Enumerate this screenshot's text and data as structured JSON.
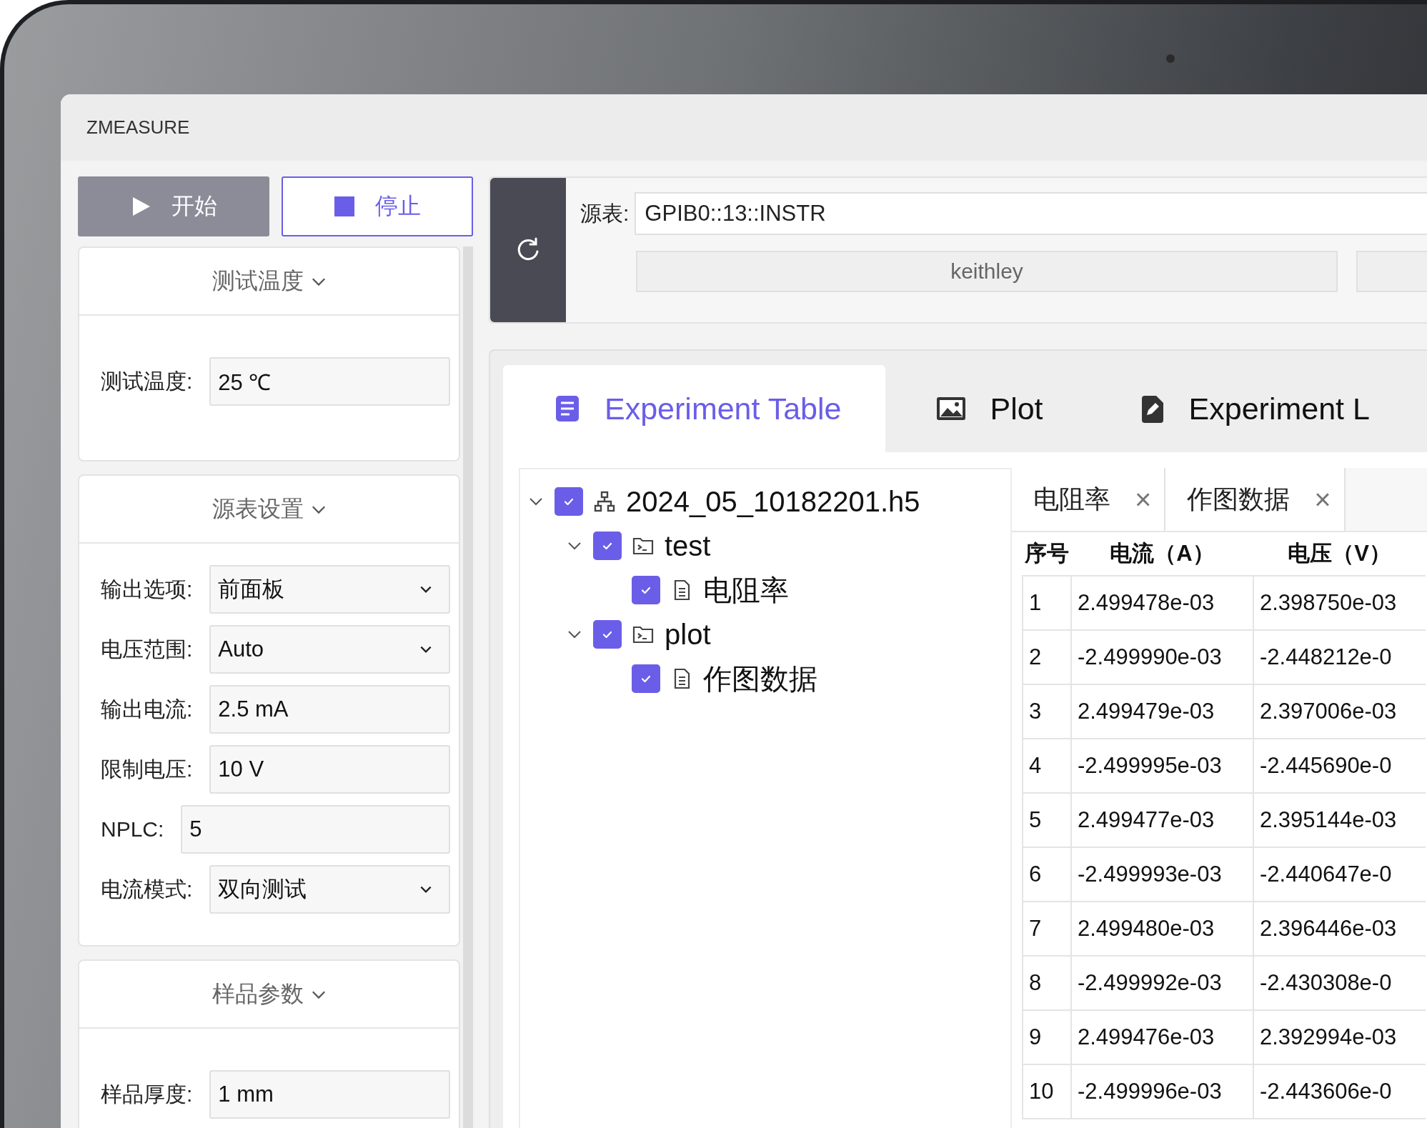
{
  "window": {
    "title": "ZMEASURE"
  },
  "run_buttons": [
    {
      "label": "开始",
      "kind": "start",
      "disabled": true
    },
    {
      "label": "停止",
      "kind": "stop",
      "disabled": false
    }
  ],
  "settings_sections": [
    {
      "title": "测试温度",
      "expanded": true,
      "fields": [
        {
          "label": "测试温度:",
          "value": "25 ℃",
          "kind": "input"
        }
      ]
    },
    {
      "title": "源表设置",
      "expanded": true,
      "fields": [
        {
          "label": "输出选项:",
          "value": "前面板",
          "kind": "select"
        },
        {
          "label": "电压范围:",
          "value": "Auto",
          "kind": "select"
        },
        {
          "label": "输出电流:",
          "value": "2.5 mA",
          "kind": "input"
        },
        {
          "label": "限制电压:",
          "value": "10 V",
          "kind": "input"
        },
        {
          "label": "NPLC:",
          "value": "5",
          "kind": "input"
        },
        {
          "label": "电流模式:",
          "value": "双向测试",
          "kind": "select"
        }
      ]
    },
    {
      "title": "样品参数",
      "expanded": true,
      "fields": [
        {
          "label": "样品厚度:",
          "value": "1 mm",
          "kind": "input"
        }
      ]
    }
  ],
  "source": {
    "label": "源表:",
    "value": "GPIB0::13::INSTR",
    "device": "keithley"
  },
  "tabs": [
    {
      "label": "Experiment Table",
      "kind": "table",
      "selected": true
    },
    {
      "label": "Plot",
      "kind": "image",
      "selected": false
    },
    {
      "label": "Experiment L",
      "kind": "edit",
      "selected": false
    }
  ],
  "tree": [
    {
      "label": "2024_05_10182201.h5",
      "kind": "file",
      "checked": true,
      "expanded": true,
      "children": [
        {
          "label": "test",
          "kind": "group",
          "checked": true,
          "expanded": true,
          "children": [
            {
              "label": "电阻率",
              "kind": "dataset",
              "checked": true
            }
          ]
        },
        {
          "label": "plot",
          "kind": "group",
          "checked": true,
          "expanded": true,
          "children": [
            {
              "label": "作图数据",
              "kind": "dataset",
              "checked": true
            }
          ]
        }
      ]
    }
  ],
  "data_tabs": [
    {
      "label": "电阻率",
      "close": "×"
    },
    {
      "label": "作图数据",
      "close": "×"
    }
  ],
  "table": {
    "columns": [
      "序号",
      "电流（A）",
      "电压（V）"
    ],
    "rows": [
      [
        "1",
        "2.499478e-03",
        "2.398750e-03"
      ],
      [
        "2",
        "-2.499990e-03",
        "-2.448212e-0"
      ],
      [
        "3",
        "2.499479e-03",
        "2.397006e-03"
      ],
      [
        "4",
        "-2.499995e-03",
        "-2.445690e-0"
      ],
      [
        "5",
        "2.499477e-03",
        "2.395144e-03"
      ],
      [
        "6",
        "-2.499993e-03",
        "-2.440647e-0"
      ],
      [
        "7",
        "2.499480e-03",
        "2.396446e-03"
      ],
      [
        "8",
        "-2.499992e-03",
        "-2.430308e-0"
      ],
      [
        "9",
        "2.499476e-03",
        "2.392994e-03"
      ],
      [
        "10",
        "-2.499996e-03",
        "-2.443606e-0"
      ]
    ]
  }
}
